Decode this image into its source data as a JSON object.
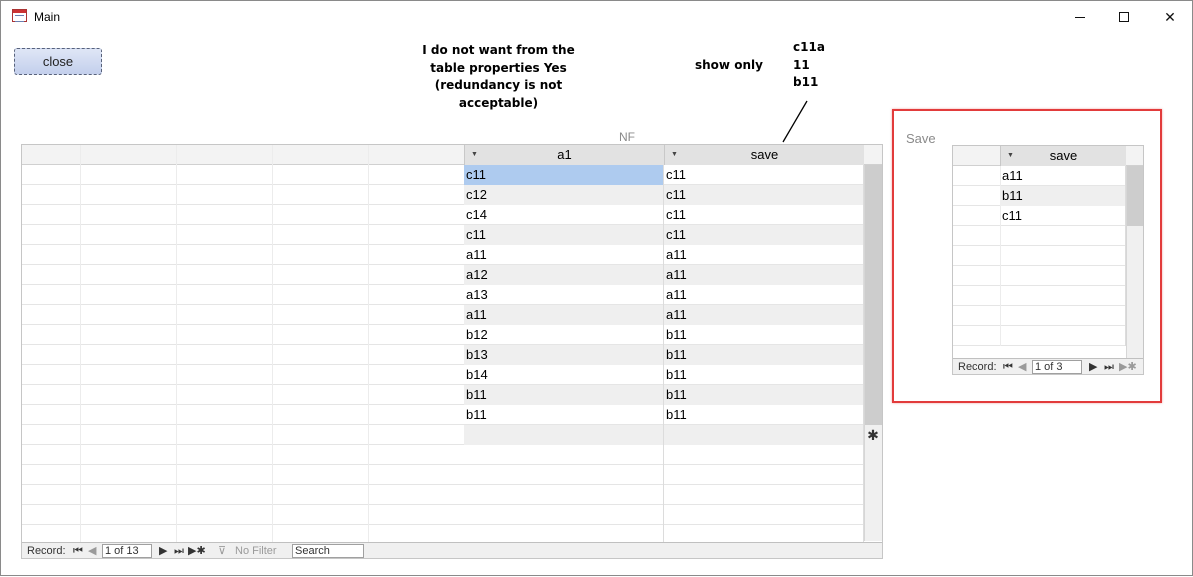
{
  "window": {
    "title": "Main",
    "controls": {
      "minimize": "—",
      "maximize": "☐",
      "close": "✕"
    }
  },
  "form": {
    "close_label": "close",
    "note_lines": [
      "I do not want from the",
      "table properties Yes",
      "(redundancy is not",
      "acceptable)"
    ],
    "show_only": "show only",
    "values_list": [
      "c11a",
      "11",
      "b11"
    ],
    "nf_label": "NF",
    "save_label": "Save"
  },
  "main_table": {
    "columns": [
      "a1",
      "save"
    ],
    "rows": [
      [
        "c11",
        "c11"
      ],
      [
        "c12",
        "c11"
      ],
      [
        "c14",
        "c11"
      ],
      [
        "c11",
        "c11"
      ],
      [
        "a11",
        "a11"
      ],
      [
        "a12",
        "a11"
      ],
      [
        "a13",
        "a11"
      ],
      [
        "a11",
        "a11"
      ],
      [
        "b12",
        "b11"
      ],
      [
        "b13",
        "b11"
      ],
      [
        "b14",
        "b11"
      ],
      [
        "b11",
        "b11"
      ],
      [
        "b11",
        "b11"
      ]
    ],
    "new_row_marker": "✱",
    "nav": {
      "record_label": "Record:",
      "position": "1 of 13",
      "filter_label": "No Filter",
      "search_value": "Search"
    }
  },
  "save_table": {
    "columns": [
      "save"
    ],
    "rows": [
      "a11",
      "b11",
      "c11"
    ],
    "nav": {
      "record_label": "Record:",
      "position": "1 of 3"
    }
  },
  "colors": {
    "highlight_box": "#e23b3b",
    "selected_cell": "#aecbef"
  }
}
